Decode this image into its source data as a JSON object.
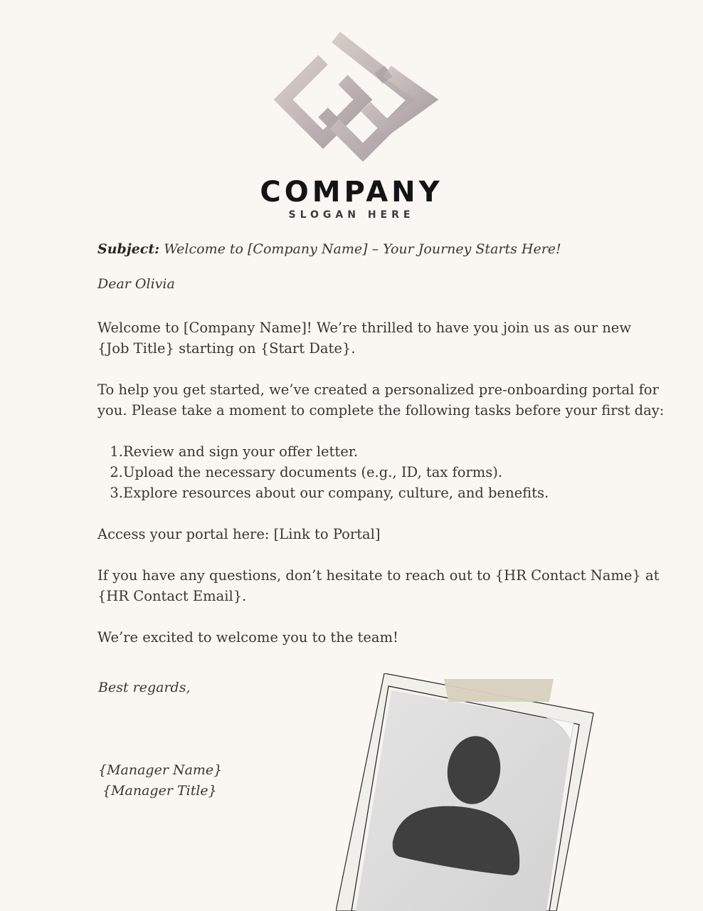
{
  "logo": {
    "company": "COMPANY",
    "slogan": "SLOGAN HERE"
  },
  "letter": {
    "subject_label": "Subject:",
    "subject_text": " Welcome to [Company Name] – Your Journey Starts Here!",
    "greeting": "Dear Olivia",
    "welcome": "Welcome to [Company Name]! We’re thrilled to have you join us as our new {Job Title} starting on {Start Date}.",
    "help": "To help you get started, we’ve created a personalized pre-onboarding portal for you. Please take a moment to complete the following tasks before your first day:",
    "tasks": [
      {
        "num": "1.",
        "text": "Review and sign your offer letter."
      },
      {
        "num": "2.",
        "text": "Upload the necessary documents (e.g., ID, tax forms)."
      },
      {
        "num": "3.",
        "text": "Explore resources about our company, culture, and benefits."
      }
    ],
    "portal": "Access your portal here: [Link to Portal]",
    "questions": "If you have any questions, don’t hesitate to reach out to {HR Contact Name} at {HR Contact Email}.",
    "excited": "We’re excited to welcome you to the team!",
    "closing": "Best regards,",
    "manager_name": "{Manager Name}",
    "manager_title": "{Manager Title}"
  },
  "colors": {
    "background": "#faf6f1",
    "text": "#3a3533",
    "logo_mark": "#b9aeac",
    "photo_backing": "#f1efea",
    "tape": "#d8d0bd",
    "avatar": "#3f3f3f"
  },
  "icons": {
    "logo": "interlocking-diamond-logo",
    "avatar": "person-avatar-icon",
    "tape": "masking-tape"
  }
}
